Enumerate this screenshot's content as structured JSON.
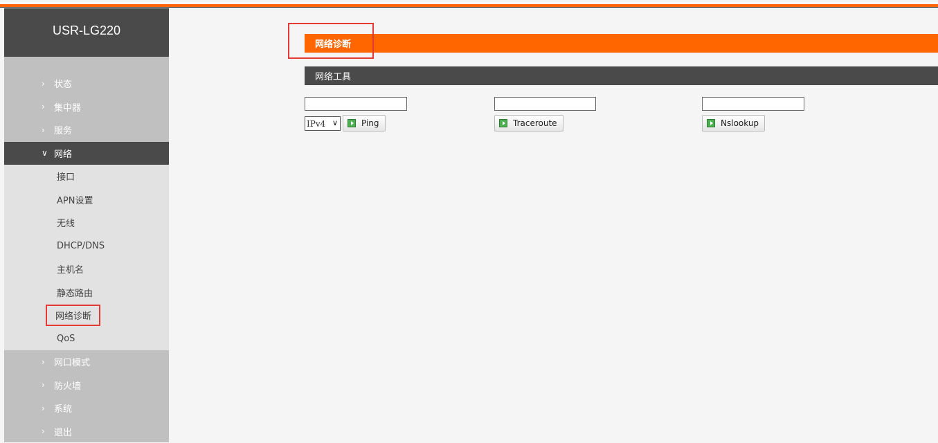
{
  "brand": "USR-LG220",
  "menu": {
    "items_before": [
      {
        "label": "状态"
      },
      {
        "label": "集中器"
      },
      {
        "label": "服务"
      }
    ],
    "active": {
      "label": "网络"
    },
    "sub_items": [
      {
        "label": "接口"
      },
      {
        "label": "APN设置"
      },
      {
        "label": "无线"
      },
      {
        "label": "DHCP/DNS"
      },
      {
        "label": "主机名"
      },
      {
        "label": "静态路由"
      },
      {
        "label": "网络诊断"
      },
      {
        "label": "QoS"
      }
    ],
    "items_after": [
      {
        "label": "网口模式"
      },
      {
        "label": "防火墙"
      },
      {
        "label": "系统"
      },
      {
        "label": "退出"
      }
    ],
    "chevron_collapsed": "›",
    "chevron_expanded": "∨"
  },
  "page": {
    "title": "网络诊断",
    "section_title": "网络工具"
  },
  "tools": {
    "ping_input_value": "",
    "protocol_selected": "IPv4",
    "ping_label": "Ping",
    "traceroute_input_value": "",
    "traceroute_label": "Traceroute",
    "nslookup_input_value": "",
    "nslookup_label": "Nslookup"
  },
  "colors": {
    "accent": "#ff6600",
    "dark": "#4a4a4a",
    "highlight": "#e53935"
  }
}
